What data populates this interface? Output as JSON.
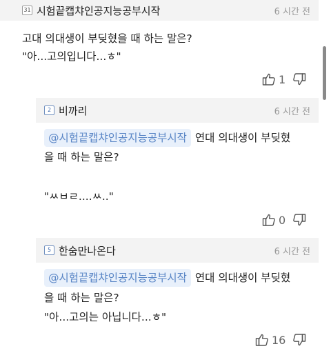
{
  "comments": [
    {
      "level": "31",
      "nickname": "시험끝캡챠인공지능공부시작",
      "time": "6 시간 전",
      "lines": [
        "고대 의대생이 부딪혔을 때 하는 말은?",
        "\"아...고의입니다...ㅎ\""
      ],
      "likes": "1"
    },
    {
      "level": "2",
      "nickname": "비까리",
      "time": "6 시간 전",
      "mention": "@시험끝캡챠인공지능공부시작",
      "line1_rest": "연대 의대생이 부딪혔",
      "line2": "을 때 하는 말은?",
      "line3": "\"ㅆㅂㄹ....ㅆ..\"",
      "likes": "0"
    },
    {
      "level": "5",
      "nickname": "한숨만나온다",
      "time": "6 시간 전",
      "mention": "@시험끝캡챠인공지능공부시작",
      "line1_rest": "연대 의대생이 부딪혔",
      "line2": "을 때 하는 말은?",
      "line3": "\"아...고의는 아닙니다...ㅎ\"",
      "likes": "16"
    }
  ],
  "icons": {
    "like": "thumbs-up-icon",
    "dislike": "thumbs-down-icon"
  }
}
